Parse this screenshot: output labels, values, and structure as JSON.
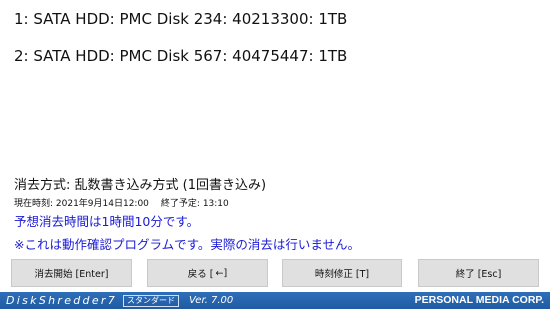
{
  "disks": [
    {
      "line": "1: SATA HDD: PMC Disk 234: 40213300: 1TB"
    },
    {
      "line": "2: SATA HDD: PMC Disk 567: 40475447: 1TB"
    }
  ],
  "erase": {
    "method": "消去方式: 乱数書き込み方式 (1回書き込み)",
    "current_time": "現在時刻: 2021年9月14日12:00",
    "end_time": "終了予定: 13:10",
    "estimate": "予想消去時間は1時間10分です。",
    "warning": "※これは動作確認プログラムです。実際の消去は行いません。"
  },
  "buttons": {
    "start_label": "消去開始 [Enter]",
    "back_label": "戻る [",
    "back_arrow": "←",
    "back_close": "]",
    "time_label": "時刻修正 [T]",
    "exit_label": "終了 [Esc]"
  },
  "footer": {
    "product": "DiskShredder7",
    "edition": "スタンダード",
    "version": "Ver. 7.00",
    "company": "PERSONAL MEDIA CORP."
  },
  "colors": {
    "info_text": "#1a1ad6",
    "footer_bg": "#2f6eb8",
    "button_bg": "#e0e0e0"
  }
}
